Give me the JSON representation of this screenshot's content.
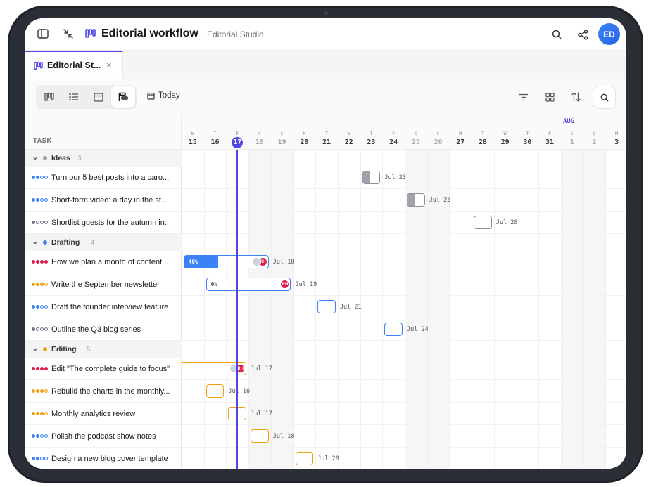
{
  "header": {
    "title": "Editorial workflow",
    "workspace": "Editorial Studio",
    "avatar_initials": "ED"
  },
  "tab": {
    "label": "Editorial St...",
    "close": "×"
  },
  "toolbar": {
    "today_label": "Today"
  },
  "timeline": {
    "task_header": "TASK",
    "month_label": "AUG",
    "today_index": 2,
    "days": [
      {
        "dow": "W",
        "num": "15"
      },
      {
        "dow": "T",
        "num": "16"
      },
      {
        "dow": "F",
        "num": "17"
      },
      {
        "dow": "S",
        "num": "18",
        "weekend": true
      },
      {
        "dow": "S",
        "num": "19",
        "weekend": true
      },
      {
        "dow": "M",
        "num": "20"
      },
      {
        "dow": "T",
        "num": "21"
      },
      {
        "dow": "W",
        "num": "22"
      },
      {
        "dow": "T",
        "num": "23"
      },
      {
        "dow": "F",
        "num": "24"
      },
      {
        "dow": "S",
        "num": "25",
        "weekend": true
      },
      {
        "dow": "S",
        "num": "26",
        "weekend": true
      },
      {
        "dow": "M",
        "num": "27"
      },
      {
        "dow": "T",
        "num": "28"
      },
      {
        "dow": "W",
        "num": "29"
      },
      {
        "dow": "T",
        "num": "30"
      },
      {
        "dow": "F",
        "num": "31"
      },
      {
        "dow": "S",
        "num": "1",
        "weekend": true
      },
      {
        "dow": "S",
        "num": "2",
        "weekend": true
      },
      {
        "dow": "M",
        "num": "3"
      }
    ]
  },
  "colors": {
    "high": "#e11d48",
    "medium": "#f59e0b",
    "low": "#3b82f6",
    "none": "#6b7280",
    "accent": "#4f46e5",
    "ideas": "#9ca3af",
    "drafting": "#3b82f6",
    "editing": "#f59e0b"
  },
  "groups": [
    {
      "name": "Ideas",
      "count": "3",
      "color_key": "ideas",
      "tasks": [
        {
          "name": "Turn our 5 best posts into a caro...",
          "priority": "low",
          "start": 8,
          "end": 8,
          "label": "Jul 23",
          "style": "ideas"
        },
        {
          "name": "Short-form video: a day in the st...",
          "priority": "low",
          "start": 10,
          "end": 10,
          "label": "Jul 25",
          "style": "ideas"
        },
        {
          "name": "Shortlist guests for the autumn in...",
          "priority": "none",
          "start": 13,
          "end": 13,
          "label": "Jul 28",
          "style": "ideas-empty"
        }
      ]
    },
    {
      "name": "Drafting",
      "count": "4",
      "color_key": "drafting",
      "tasks": [
        {
          "name": "How we plan a month of content ...",
          "priority": "high",
          "start": 0,
          "end": 3,
          "label": "Jul 18",
          "style": "drafting",
          "progress": 40,
          "progress_label": "40%",
          "avatars": [
            "cat",
            "RH"
          ]
        },
        {
          "name": "Write the September newsletter",
          "priority": "medium",
          "start": 1,
          "end": 4,
          "label": "Jul 19",
          "style": "drafting",
          "progress": 0,
          "progress_label": "0%",
          "avatars": [
            "RH"
          ]
        },
        {
          "name": "Draft the founder interview feature",
          "priority": "low",
          "start": 6,
          "end": 6,
          "label": "Jul 21",
          "style": "drafting"
        },
        {
          "name": "Outline the Q3 blog series",
          "priority": "none",
          "start": 9,
          "end": 9,
          "label": "Jul 24",
          "style": "drafting"
        }
      ]
    },
    {
      "name": "Editing",
      "count": "5",
      "color_key": "editing",
      "tasks": [
        {
          "name": "Edit \"The complete guide to focus\"",
          "priority": "high",
          "start": -2,
          "end": 2,
          "label": "Jul 17",
          "style": "editing",
          "avatars": [
            "cat",
            "RH"
          ]
        },
        {
          "name": "Rebuild the charts in the monthly...",
          "priority": "medium",
          "start": 1,
          "end": 1,
          "label": "Jul 16",
          "style": "editing"
        },
        {
          "name": "Monthly analytics review",
          "priority": "medium",
          "start": 2,
          "end": 2,
          "label": "Jul 17",
          "style": "editing"
        },
        {
          "name": "Polish the podcast show notes",
          "priority": "low",
          "start": 3,
          "end": 3,
          "label": "Jul 18",
          "style": "editing"
        },
        {
          "name": "Design a new blog cover template",
          "priority": "low",
          "start": 5,
          "end": 5,
          "label": "Jul 20",
          "style": "editing"
        }
      ]
    }
  ]
}
